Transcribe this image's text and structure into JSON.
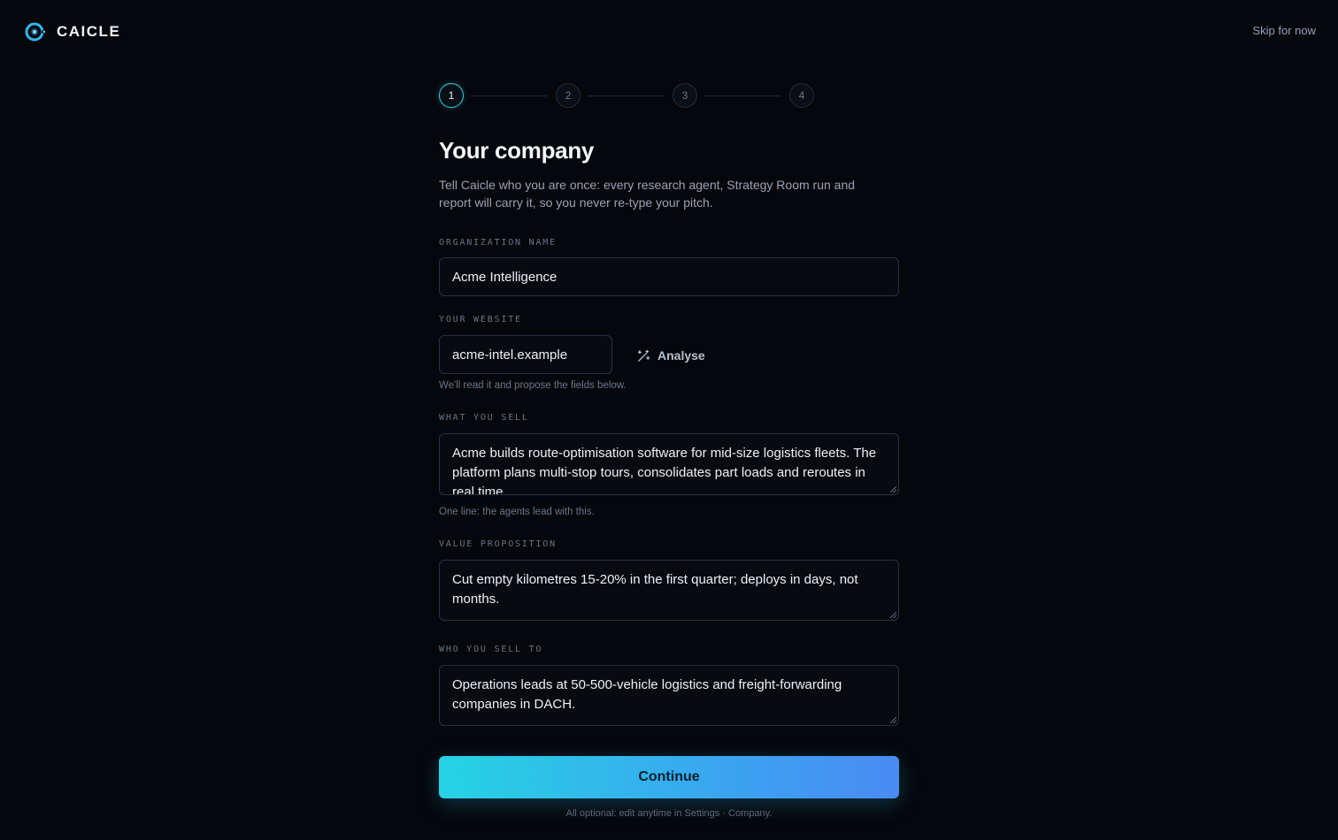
{
  "brand": {
    "name": "CAICLE"
  },
  "header": {
    "skip_label": "Skip for now"
  },
  "stepper": {
    "steps": [
      "1",
      "2",
      "3",
      "4"
    ],
    "active_index": 0
  },
  "page": {
    "title": "Your company",
    "description": "Tell Caicle who you are once: every research agent, Strategy Room run and report will carry it, so you never re-type your pitch."
  },
  "fields": {
    "organization": {
      "label": "ORGANIZATION NAME",
      "value": "Acme Intelligence"
    },
    "website": {
      "label": "YOUR WEBSITE",
      "value": "acme-intel.example",
      "analyse_label": "Analyse",
      "hint": "We'll read it and propose the fields below."
    },
    "what_you_sell": {
      "label": "WHAT YOU SELL",
      "value": "Acme builds route-optimisation software for mid-size logistics fleets. The platform plans multi-stop tours, consolidates part loads and reroutes in real time.",
      "hint": "One line: the agents lead with this."
    },
    "value_proposition": {
      "label": "VALUE PROPOSITION",
      "value": "Cut empty kilometres 15-20% in the first quarter; deploys in days, not months."
    },
    "who_you_sell_to": {
      "label": "WHO YOU SELL TO",
      "value": "Operations leads at 50-500-vehicle logistics and freight-forwarding companies in DACH."
    }
  },
  "actions": {
    "continue_label": "Continue",
    "footnote": "All optional: edit anytime in Settings · Company."
  },
  "colors": {
    "accent": "#2ad1e0",
    "background": "#05070d",
    "button_gradient_end": "#4a8af3"
  },
  "icons": {
    "brand": "caicle-logo-icon",
    "analyse": "magic-wand-icon"
  }
}
